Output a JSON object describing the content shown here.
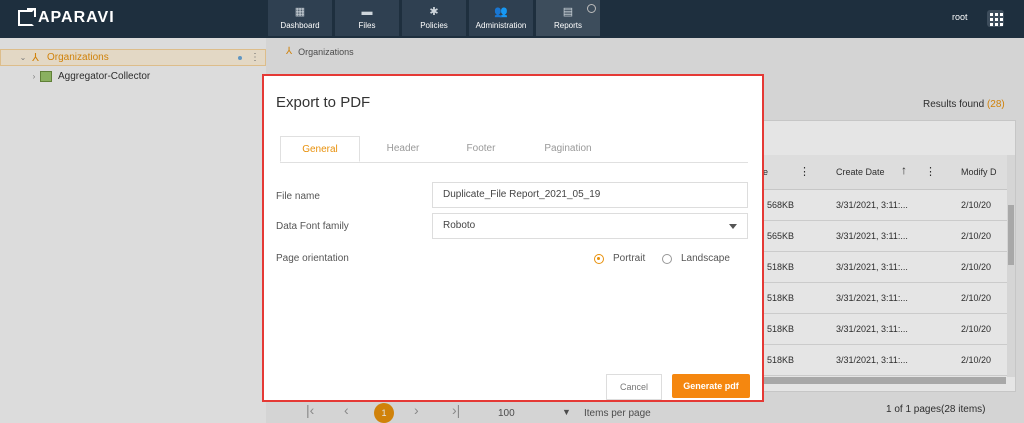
{
  "app": {
    "logo_text": "APARAVI",
    "user": "root"
  },
  "nav": [
    {
      "label": "Dashboard",
      "icon": "dashboard-icon"
    },
    {
      "label": "Files",
      "icon": "folder-icon"
    },
    {
      "label": "Policies",
      "icon": "gear-icon"
    },
    {
      "label": "Administration",
      "icon": "users-icon"
    },
    {
      "label": "Reports",
      "icon": "clipboard-icon"
    }
  ],
  "sidebar": {
    "items": [
      {
        "label": "Organizations",
        "selected": true
      },
      {
        "label": "Aggregator-Collector",
        "selected": false
      }
    ]
  },
  "breadcrumb": {
    "label": "Organizations"
  },
  "results": {
    "label": "Results found",
    "count": "(28)"
  },
  "table": {
    "headers": [
      "e",
      "Create Date",
      "Modify D"
    ],
    "rows": [
      [
        "568KB",
        "3/31/2021, 3:11:...",
        "2/10/20"
      ],
      [
        "565KB",
        "3/31/2021, 3:11:...",
        "2/10/20"
      ],
      [
        "518KB",
        "3/31/2021, 3:11:...",
        "2/10/20"
      ],
      [
        "518KB",
        "3/31/2021, 3:11:...",
        "2/10/20"
      ],
      [
        "518KB",
        "3/31/2021, 3:11:...",
        "2/10/20"
      ],
      [
        "518KB",
        "3/31/2021, 3:11:...",
        "2/10/20"
      ]
    ]
  },
  "pager": {
    "current": "1",
    "per_page": "100",
    "per_page_label": "Items per page",
    "info": "1 of 1 pages(28 items)"
  },
  "dialog": {
    "title": "Export to PDF",
    "tabs": [
      {
        "label": "General",
        "active": true
      },
      {
        "label": "Header",
        "active": false
      },
      {
        "label": "Footer",
        "active": false
      },
      {
        "label": "Pagination",
        "active": false
      }
    ],
    "file_name_label": "File name",
    "file_name_value": "Duplicate_File Report_2021_05_19",
    "font_label": "Data Font family",
    "font_value": "Roboto",
    "orientation_label": "Page orientation",
    "orientation_options": [
      {
        "label": "Portrait",
        "checked": true
      },
      {
        "label": "Landscape",
        "checked": false
      }
    ],
    "cancel_label": "Cancel",
    "generate_label": "Generate pdf"
  },
  "colors": {
    "accent": "#f5870f",
    "topbar": "#1e2f3e",
    "highlight_border": "#e53935"
  }
}
